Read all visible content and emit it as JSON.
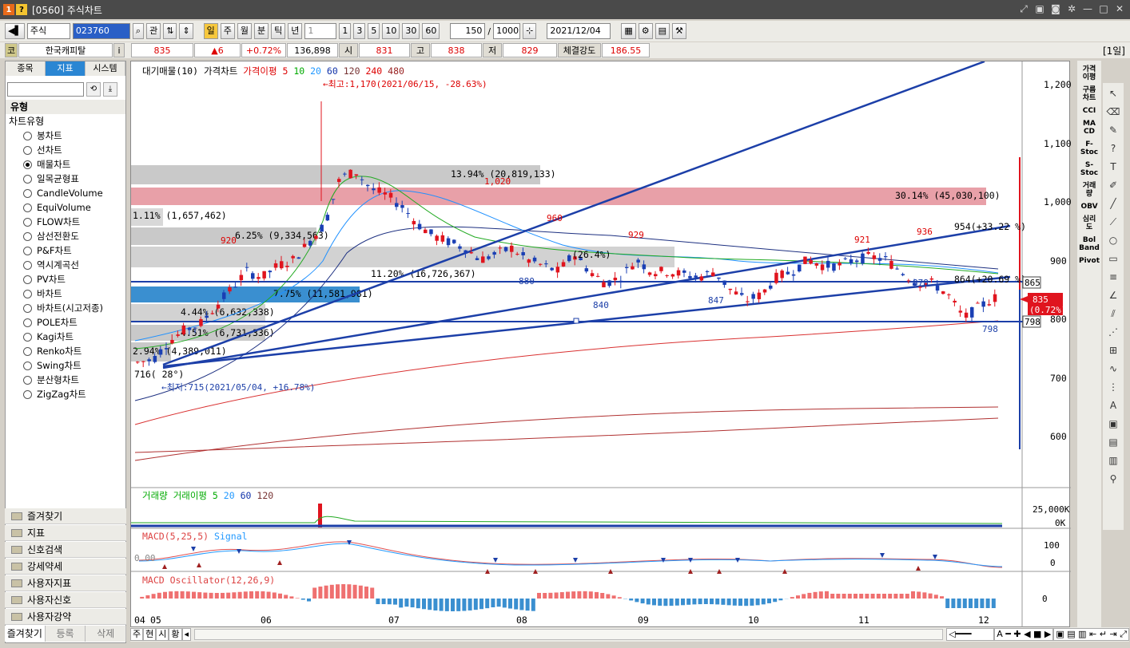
{
  "window": {
    "badge1": "1",
    "badge2": "?",
    "title": "[0560] 주식차트"
  },
  "toolbar": {
    "market": "주식",
    "code": "023760",
    "gwan": "관",
    "periods": [
      "일",
      "주",
      "월",
      "분",
      "틱",
      "년"
    ],
    "period_selected": "일",
    "interval": "1",
    "quick": [
      "1",
      "3",
      "5",
      "10",
      "30",
      "60"
    ],
    "count": "150",
    "slash": "/",
    "total": "1000",
    "date": "2021/12/04"
  },
  "quote": {
    "gu": "코",
    "name": "한국캐피탈",
    "info": "i",
    "price": "835",
    "change": "▲6",
    "rate": "+0.72%",
    "volume": "136,898",
    "open_label": "시",
    "open": "831",
    "high_label": "고",
    "high": "838",
    "low_label": "저",
    "low": "829",
    "strength_label": "체결강도",
    "strength": "186.55",
    "period_tag": "[1일]"
  },
  "left": {
    "tabs": [
      "종목",
      "지표",
      "시스템"
    ],
    "group_title": "유형",
    "tree_header": "차트유형",
    "types": [
      "봉차트",
      "선차트",
      "매물차트",
      "일목균형표",
      "CandleVolume",
      "EquiVolume",
      "FLOW차트",
      "삼선전환도",
      "P&F차트",
      "역시계곡선",
      "PV차트",
      "바차트",
      "바차트(시고저종)",
      "POLE차트",
      "Kagi차트",
      "Renko차트",
      "Swing차트",
      "분산형차트",
      "ZigZag차트"
    ],
    "selected_type": "매물차트",
    "folders": [
      "즐겨찾기",
      "지표",
      "신호검색",
      "강세약세",
      "사용자지표",
      "사용자신호",
      "사용자강약"
    ],
    "bottom_tabs": [
      "즐겨찾기",
      "등록",
      "삭제"
    ]
  },
  "chart": {
    "legend_main": [
      "대기매물(10)",
      "가격차트",
      "가격이평 5",
      "10",
      "20",
      "60",
      "120",
      "240",
      "480"
    ],
    "legend_volume": [
      "거래량",
      "거래이평 5",
      "20",
      "60",
      "120"
    ],
    "legend_macd": [
      "MACD(5,25,5)",
      "Signal"
    ],
    "legend_osc": [
      "MACD Oscillator(12,26,9)"
    ],
    "high_note": "←최고:1,170(2021/06/15, -28.63%)",
    "low_note": "←최저:715(2021/05/04, +16.78%)",
    "price_axis": [
      "1,200",
      "1,100",
      "1,000",
      "900",
      "800",
      "700",
      "600"
    ],
    "volume_axis": [
      "25,000K",
      "0K"
    ],
    "macd_axis": [
      "100",
      "0"
    ],
    "osc_axis": [
      "0"
    ],
    "macd_zero_label": "0.00",
    "x_axis": [
      "04",
      "05",
      "06",
      "07",
      "08",
      "09",
      "10",
      "11",
      "12"
    ],
    "current_price_box": {
      "price": "835",
      "rate": "(0.72%)"
    },
    "level_labels": [
      "865",
      "798"
    ],
    "volume_profile": [
      {
        "label": "13.94% (20,819,133)"
      },
      {
        "label": "30.14% (45,030,100)"
      },
      {
        "label": "1.11% (1,657,462)"
      },
      {
        "label": "6.25% (9,334,563)"
      },
      {
        "label": "11.20% (16,726,367)"
      },
      {
        "label": "7.75% (11,581,981)"
      },
      {
        "label": "4.44% (6,632,338)"
      },
      {
        "label": "4.51% (6,731,336)"
      },
      {
        "label": "2.94% (4,389,011)"
      }
    ],
    "annotations": {
      "p1020": "1,020",
      "p960": "960",
      "p929": "929",
      "p921": "921",
      "p936": "936",
      "p920": "920",
      "p880": "880",
      "p840": "840",
      "p847": "847",
      "p878": "878",
      "p798": "798",
      "p716": "716( 28°)",
      "tl954": "954(+33.22 %)",
      "tl864": "864(+20.69 %)",
      "b726": "(26.4%)"
    },
    "colors": {
      "up": "#e0141e",
      "down": "#1a3fb4",
      "trend": "#1c3fa8",
      "band": "#e8a0a8"
    }
  },
  "bottombar": {
    "tabs": [
      "주",
      "현",
      "시",
      "황"
    ]
  }
}
